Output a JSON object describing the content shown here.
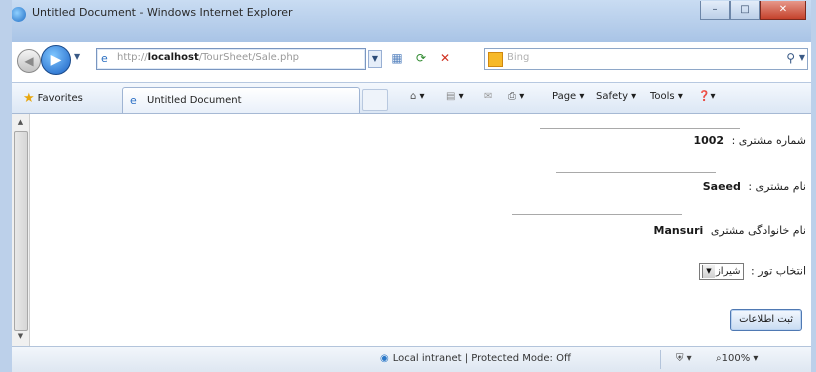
{
  "window": {
    "title": "Untitled Document - Windows Internet Explorer",
    "minimize_glyph": "–",
    "maximize_glyph": "□",
    "close_glyph": "✕"
  },
  "navigation": {
    "address_prefix": "http://",
    "address_host": "localhost",
    "address_path": "/TourSheet/Sale.php",
    "search_placeholder": "Bing",
    "back_glyph": "◀",
    "forward_glyph": "▶",
    "icons": [
      "ie-page-icon",
      "compat-view-icon",
      "refresh-icon",
      "stop-icon",
      "bing-logo-icon",
      "search-icon"
    ]
  },
  "favorites_bar": {
    "favorites_label": "Favorites",
    "tab_label": "Untitled Document",
    "commands": [
      {
        "label": "▾",
        "icon": "home-icon"
      },
      {
        "label": "▾",
        "icon": "feeds-icon"
      },
      {
        "label": "",
        "icon": "mail-icon"
      },
      {
        "label": "▾",
        "icon": "print-icon"
      },
      {
        "label": "Page ▾",
        "icon": ""
      },
      {
        "label": "Safety ▾",
        "icon": ""
      },
      {
        "label": "Tools ▾",
        "icon": ""
      },
      {
        "label": "▾",
        "icon": "help-icon"
      }
    ]
  },
  "form": {
    "customer_number_label": "شماره مشتری :",
    "customer_number_value": "1002",
    "first_name_label": "نام مشتری :",
    "first_name_value": "Saeed",
    "last_name_label": "نام خانوادگی مشتری",
    "last_name_value": "Mansuri",
    "tour_label": "انتخاب تور :",
    "tour_selected": "شیراز",
    "submit_label": "ثبت اطلاعات"
  },
  "status_bar": {
    "zone_text": "Local intranet | Protected Mode: Off",
    "zoom_text": "100%",
    "zoom_icon": "zoom-icon",
    "zone_icon": "local-intranet-icon"
  }
}
